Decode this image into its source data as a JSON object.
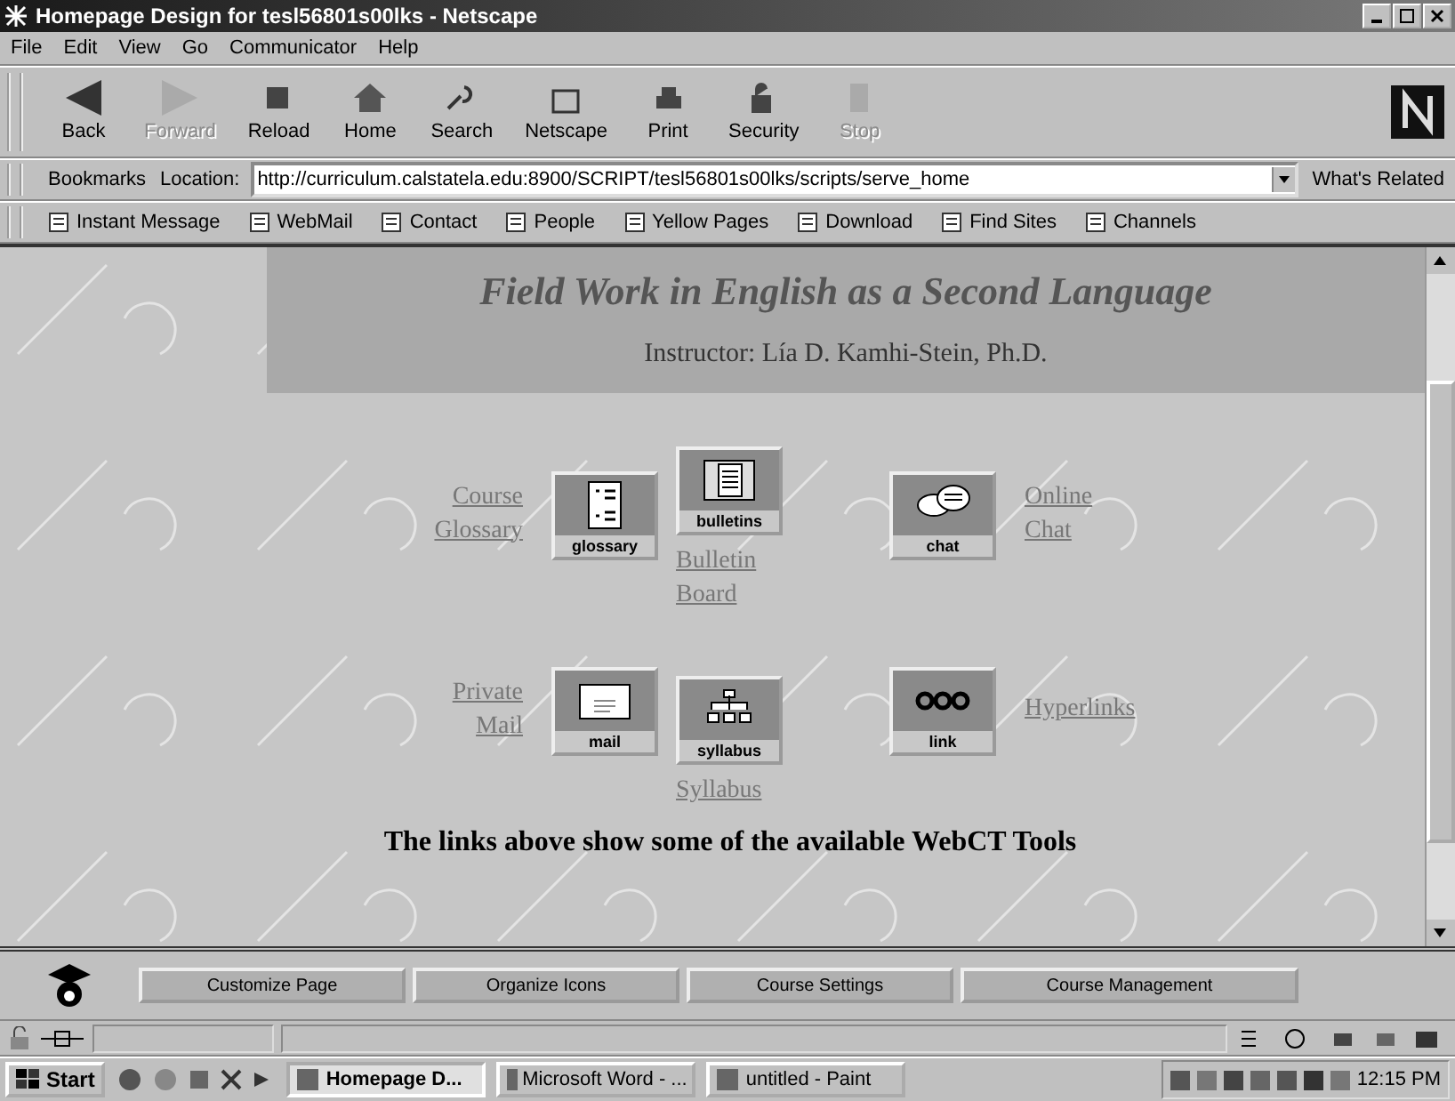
{
  "window": {
    "title": "Homepage Design for tesl56801s00lks - Netscape"
  },
  "menu": [
    "File",
    "Edit",
    "View",
    "Go",
    "Communicator",
    "Help"
  ],
  "toolbar": [
    {
      "label": "Back",
      "disabled": false
    },
    {
      "label": "Forward",
      "disabled": true
    },
    {
      "label": "Reload",
      "disabled": false
    },
    {
      "label": "Home",
      "disabled": false
    },
    {
      "label": "Search",
      "disabled": false
    },
    {
      "label": "Netscape",
      "disabled": false
    },
    {
      "label": "Print",
      "disabled": false
    },
    {
      "label": "Security",
      "disabled": false
    },
    {
      "label": "Stop",
      "disabled": true
    }
  ],
  "location_bar": {
    "bookmarks": "Bookmarks",
    "label": "Location:",
    "url": "http://curriculum.calstatela.edu:8900/SCRIPT/tesl56801s00lks/scripts/serve_home",
    "related": "What's Related"
  },
  "personal_toolbar": [
    "Instant Message",
    "WebMail",
    "Contact",
    "People",
    "Yellow Pages",
    "Download",
    "Find Sites",
    "Channels"
  ],
  "page": {
    "title": "Field Work in English as a Second Language",
    "instructor": "Instructor: Lía D. Kamhi-Stein, Ph.D.",
    "tools": [
      {
        "kind": "text-left",
        "link": [
          "Course",
          "Glossary"
        ],
        "icon_label": "glossary"
      },
      {
        "kind": "text-below",
        "link": [
          "Bulletin",
          "Board"
        ],
        "icon_label": "bulletins"
      },
      {
        "kind": "text-right",
        "link": [
          "Online",
          "Chat"
        ],
        "icon_label": "chat"
      },
      {
        "kind": "text-left",
        "link": [
          "Private",
          "Mail"
        ],
        "icon_label": "mail"
      },
      {
        "kind": "text-below",
        "link": [
          "Syllabus"
        ],
        "icon_label": "syllabus"
      },
      {
        "kind": "text-right",
        "link": [
          "Hyperlinks"
        ],
        "icon_label": "link"
      }
    ],
    "note": "The links above show some of the available WebCT Tools"
  },
  "bottom_frame": {
    "buttons": [
      "Customize Page",
      "Organize Icons",
      "Course Settings",
      "Course Management"
    ]
  },
  "taskbar": {
    "start": "Start",
    "tasks": [
      {
        "label": "Homepage D...",
        "selected": true
      },
      {
        "label": "Microsoft Word - ...",
        "selected": false
      },
      {
        "label": "untitled - Paint",
        "selected": false
      }
    ],
    "clock": "12:15 PM"
  }
}
